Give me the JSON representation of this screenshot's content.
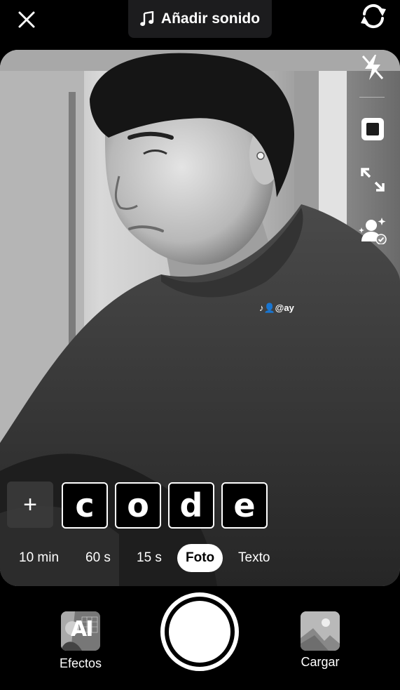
{
  "top": {
    "sound_label": "Añadir sonido"
  },
  "sticker": {
    "watermark": "♪👤@ay",
    "letters": [
      "c",
      "o",
      "d",
      "e"
    ]
  },
  "modes": [
    {
      "label": "10 min",
      "active": false
    },
    {
      "label": "60 s",
      "active": false
    },
    {
      "label": "15 s",
      "active": false
    },
    {
      "label": "Foto",
      "active": true
    },
    {
      "label": "Texto",
      "active": false
    }
  ],
  "bottom": {
    "effects_label": "Efectos",
    "effects_badge": "AI",
    "upload_label": "Cargar"
  }
}
